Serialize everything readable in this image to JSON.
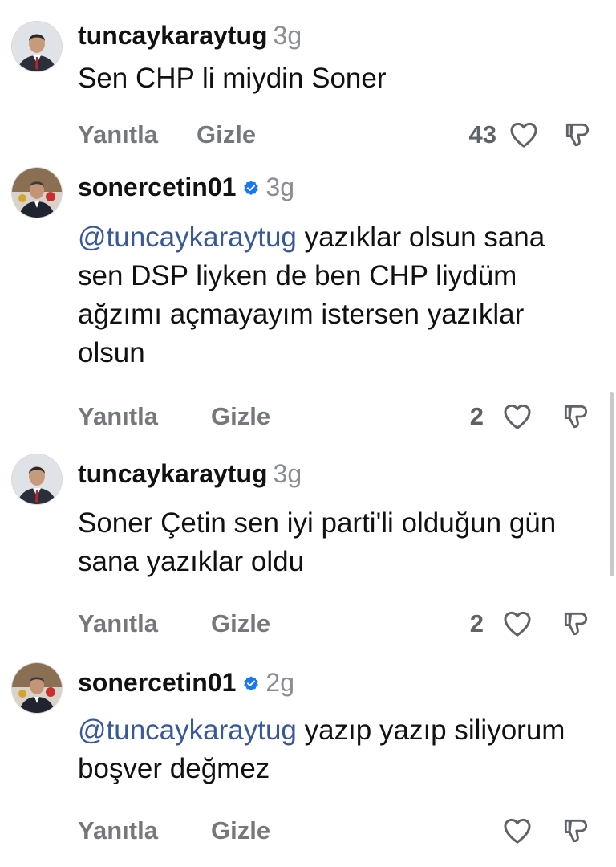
{
  "actions": {
    "reply_label": "Yanıtla",
    "hide_label": "Gizle"
  },
  "comments": [
    {
      "username": "tuncaykaraytug",
      "time": "3g",
      "mention": "",
      "text": "Sen CHP li miydin Soner",
      "likes": "43"
    },
    {
      "username": "sonercetin01",
      "time": "3g",
      "mention": "@tuncaykaraytug",
      "text": " yazıklar olsun sana sen DSP liyken de ben CHP liydüm ağzımı açmayayım istersen yazıklar olsun",
      "likes": "2"
    },
    {
      "username": "tuncaykaraytug",
      "time": "3g",
      "mention": "",
      "text": "Soner Çetin sen iyi parti'li olduğun gün sana yazıklar oldu",
      "likes": "2"
    },
    {
      "username": "sonercetin01",
      "time": "2g",
      "mention": "@tuncaykaraytug",
      "text": " yazıp yazıp siliyorum boşver değmez",
      "likes": ""
    }
  ],
  "colors": {
    "mention": "#385898",
    "verified": "#1877f2",
    "muted": "#74777c"
  },
  "icons": {
    "like": "heart-outline-icon",
    "dislike": "thumbs-down-outline-icon",
    "verified": "verified-badge-icon"
  }
}
